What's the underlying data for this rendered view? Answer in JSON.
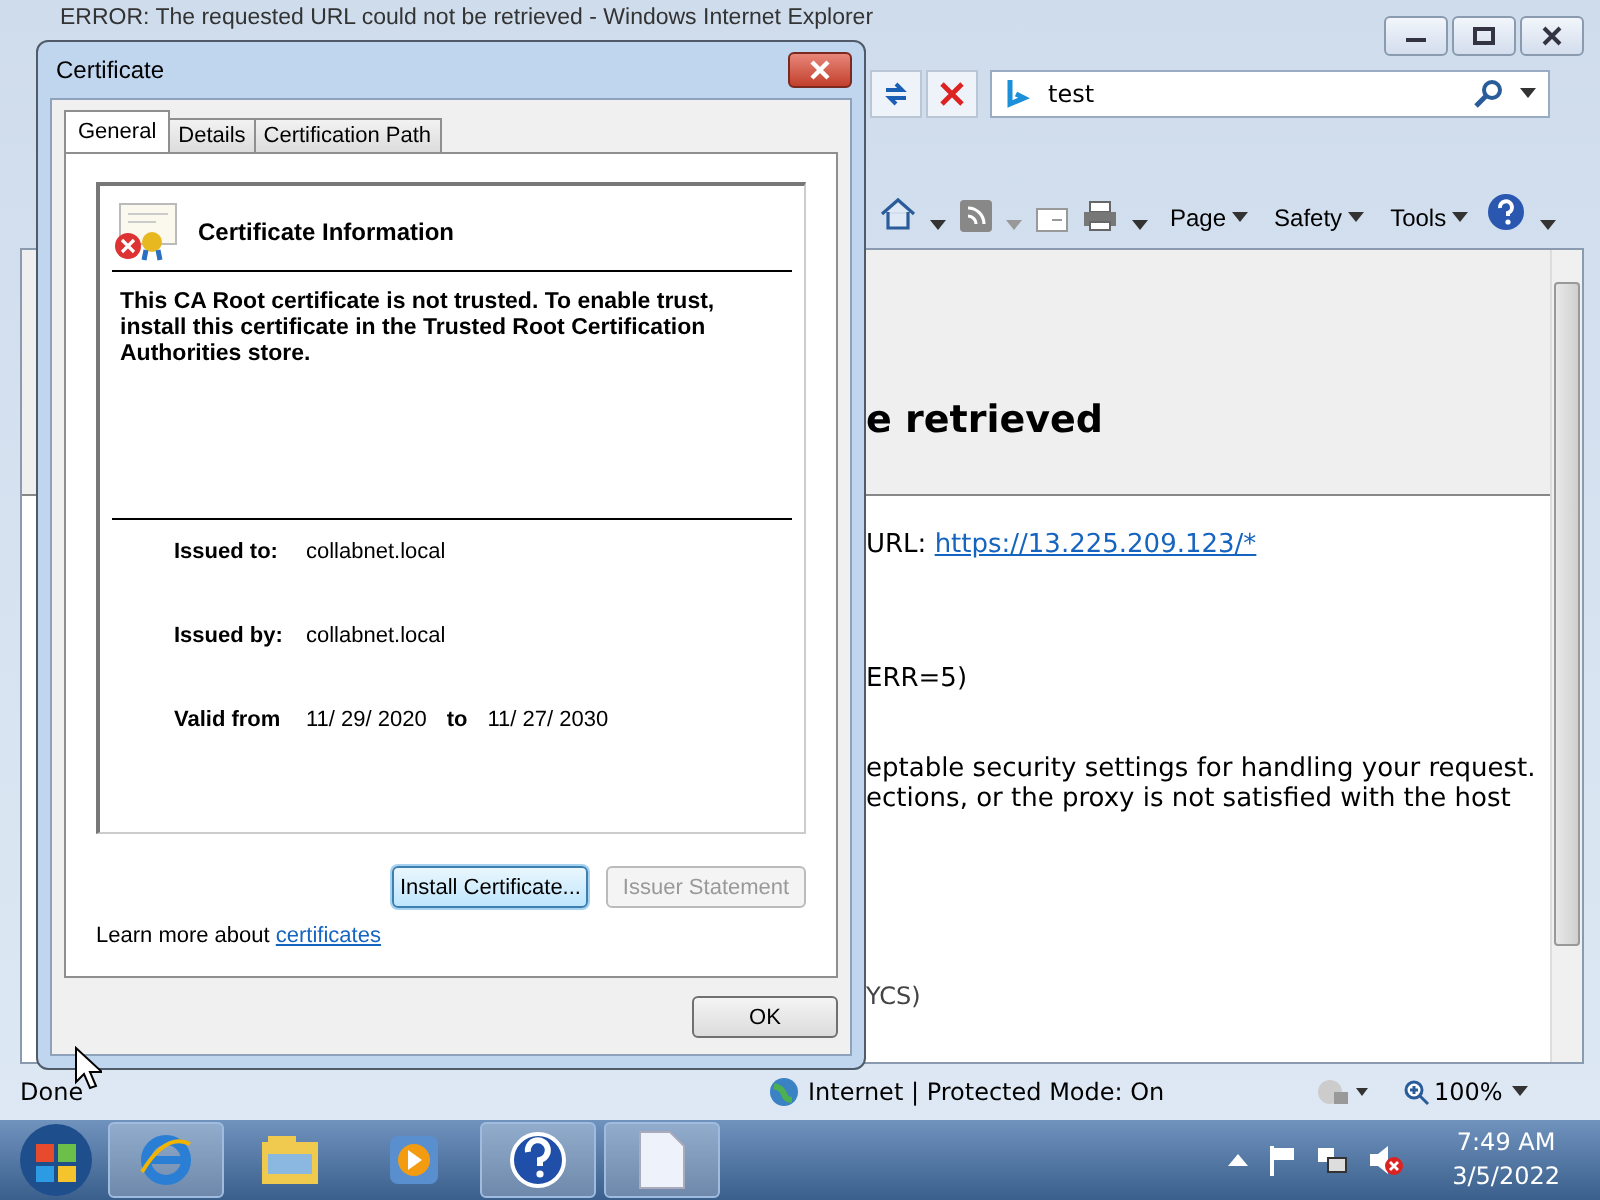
{
  "browser": {
    "title": "ERROR: The requested URL could not be retrieved - Windows Internet Explorer",
    "search": {
      "value": "test"
    },
    "commands": [
      {
        "label": "Page"
      },
      {
        "label": "Safety"
      },
      {
        "label": "Tools"
      }
    ],
    "page": {
      "heading": "e retrieved",
      "url_label": "URL:",
      "url": "https://13.225.209.123/*",
      "error": "ERR=5)",
      "lines": [
        "eptable security settings for handling your request.",
        "ections, or the proxy is not satisfied with the host"
      ],
      "footer": "YCS)"
    },
    "status_bar": {
      "text": "Done",
      "zone": "Internet | Protected Mode: On",
      "zoom": "100%"
    }
  },
  "dialog": {
    "title": "Certificate",
    "tabs": [
      {
        "label": "General",
        "selected": true
      },
      {
        "label": "Details",
        "selected": false
      },
      {
        "label": "Certification Path",
        "selected": false
      }
    ],
    "info_title": "Certificate Information",
    "message": "This CA Root certificate is not trusted. To enable trust, install this certificate in the Trusted Root Certification Authorities store.",
    "fields": [
      {
        "label": "Issued to:",
        "value": "collabnet.local"
      },
      {
        "label": "Issued by:",
        "value": "collabnet.local"
      }
    ],
    "valid": {
      "label": "Valid from",
      "from": "11/ 29/ 2020",
      "to_label": "to",
      "to": "11/ 27/ 2030"
    },
    "buttons": [
      {
        "label": "Install Certificate...",
        "disabled": false
      },
      {
        "label": "Issuer Statement",
        "disabled": true
      }
    ],
    "learn_more": {
      "text": "Learn more about",
      "link": "certificates"
    },
    "ok": "OK"
  },
  "taskbar": {
    "time": "7:49 AM",
    "date": "3/5/2022"
  }
}
